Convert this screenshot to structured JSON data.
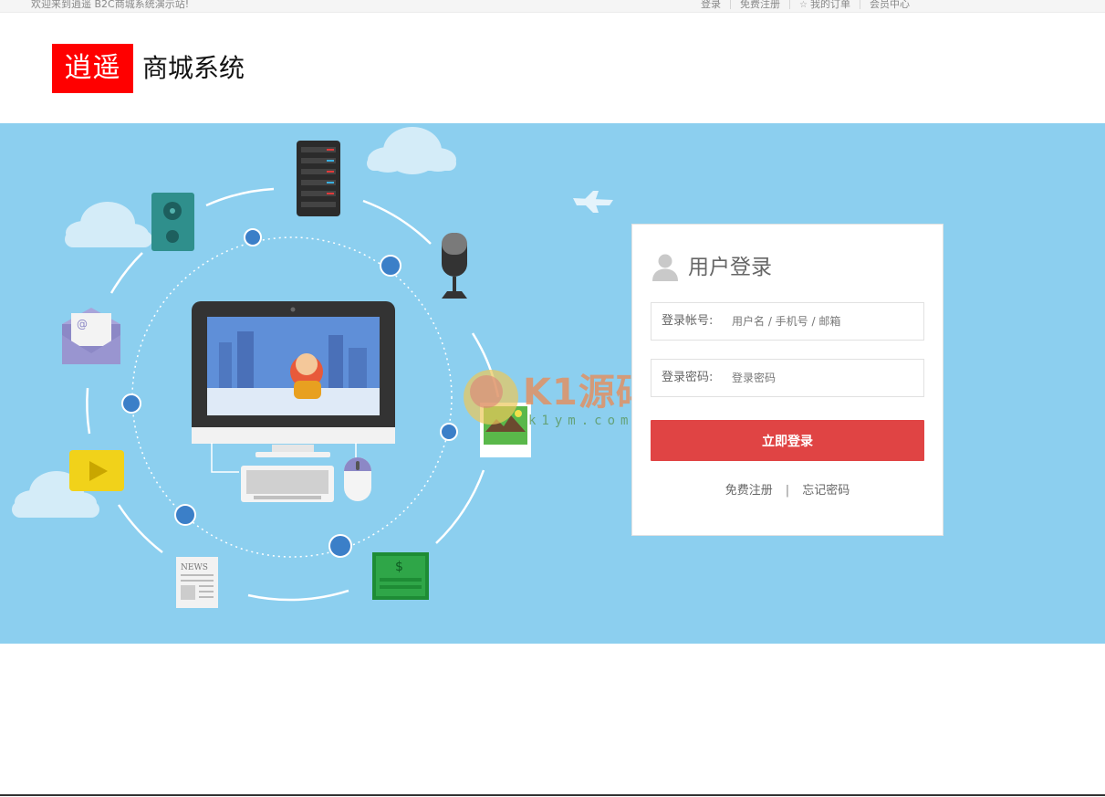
{
  "topbar": {
    "welcome": "欢迎来到逍遥 B2C商城系统演示站!",
    "links": [
      "登录",
      "免费注册",
      "我的订单",
      "会员中心"
    ]
  },
  "header": {
    "logo_mark": "逍遥",
    "logo_text": "商城系统"
  },
  "login": {
    "title": "用户登录",
    "account_label": "登录帐号:",
    "account_placeholder": "用户名 / 手机号 / 邮箱",
    "password_label": "登录密码:",
    "password_placeholder": "登录密码",
    "submit_label": "立即登录",
    "register_label": "免费注册",
    "forgot_label": "忘记密码",
    "divider": "|"
  },
  "banner": {
    "news_label": "NEWS",
    "money_label": "$",
    "email_label": "@"
  },
  "watermark": {
    "main": "K1源码",
    "sub": "k1ym.com"
  },
  "colors": {
    "brand_red": "#ff0000",
    "button_red": "#e04444",
    "banner_blue": "#8ccfef",
    "dot_blue": "#3b7fc8"
  }
}
